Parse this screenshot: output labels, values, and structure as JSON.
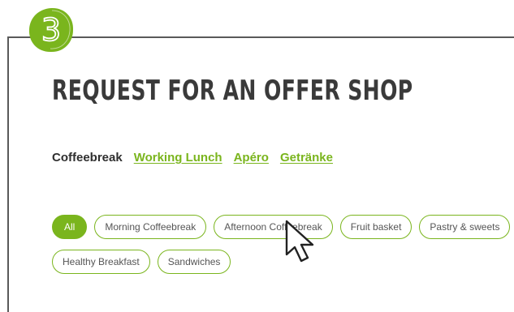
{
  "step": {
    "number": "3",
    "color": "#7ab51d"
  },
  "title": {
    "text": "Request for an offer Shop"
  },
  "nav": {
    "current": "Coffeebreak",
    "links": [
      "Working Lunch",
      "Apéro",
      "Getränke"
    ]
  },
  "filters": [
    {
      "label": "All",
      "active": true
    },
    {
      "label": "Morning Coffeebreak",
      "active": false
    },
    {
      "label": "Afternoon Coffeebreak",
      "active": false
    },
    {
      "label": "Fruit basket",
      "active": false
    },
    {
      "label": "Pastry & sweets",
      "active": false
    },
    {
      "label": "Healthy Breakfast",
      "active": false
    },
    {
      "label": "Sandwiches",
      "active": false
    }
  ],
  "colors": {
    "accent": "#7ab51d",
    "text": "#333333",
    "frame": "#5a5a5a"
  }
}
